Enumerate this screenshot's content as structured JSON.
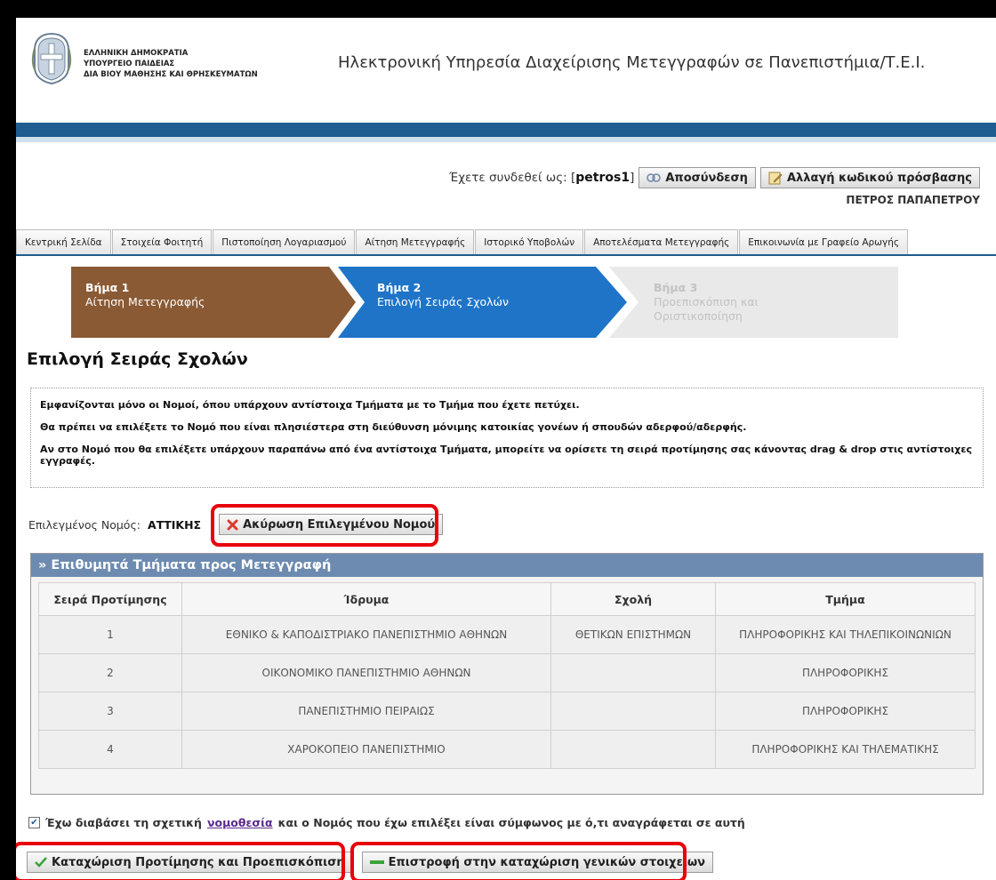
{
  "header": {
    "ministry_lines": [
      "ΕΛΛΗΝΙΚΗ ΔΗΜΟΚΡΑΤΙΑ",
      "ΥΠΟΥΡΓΕΙΟ ΠΑΙΔΕΙΑΣ",
      "ΔΙΑ ΒΙΟΥ ΜΑΘΗΣΗΣ ΚΑΙ ΘΡΗΣΚΕΥΜΑΤΩΝ"
    ],
    "service_title": "Ηλεκτρονική Υπηρεσία Διαχείρισης Μετεγγραφών σε Πανεπιστήμια/Τ.Ε.Ι.",
    "colors": {
      "bar": "#1f5c8f"
    }
  },
  "user": {
    "logged_in_label": "Έχετε συνδεθεί ως: [",
    "username": "petros1",
    "close_bracket": "]",
    "logout_label": "Αποσύνδεση",
    "change_password_label": "Αλλαγή κωδικού πρόσβασης",
    "full_name": "ΠΕΤΡΟΣ ΠΑΠΑΠΕΤΡΟΥ"
  },
  "tabs": [
    {
      "label": "Κεντρική Σελίδα"
    },
    {
      "label": "Στοιχεία Φοιτητή"
    },
    {
      "label": "Πιστοποίηση Λογαριασμού"
    },
    {
      "label": "Αίτηση Μετεγγραφής"
    },
    {
      "label": "Ιστορικό Υποβολών"
    },
    {
      "label": "Αποτελέσματα Μετεγγραφής"
    },
    {
      "label": "Επικοινωνία με Γραφείο Αρωγής"
    }
  ],
  "wizard": {
    "steps": [
      {
        "num": "Βήμα 1",
        "label": "Αίτηση Μετεγγραφής",
        "state": "done",
        "color": "#8a5a34"
      },
      {
        "num": "Βήμα 2",
        "label": "Επιλογή Σειράς Σχολών",
        "state": "current",
        "color": "#1f74c8"
      },
      {
        "num": "Βήμα 3",
        "label": "Προεπισκόπιση και Οριστικοποίηση",
        "state": "pending",
        "color": "#e9e9e9"
      }
    ]
  },
  "page_title": "Επιλογή Σειράς Σχολών",
  "info": {
    "p1": "Εμφανίζονται μόνο οι Νομοί, όπου υπάρχουν αντίστοιχα Τμήματα με το Τμήμα που έχετε πετύχει.",
    "p2": "Θα πρέπει να επιλέξετε το Νομό που είναι πλησιέστερα στη διεύθυνση μόνιμης κατοικίας γονέων ή σπουδών αδερφού/αδερφής.",
    "p3": "Αν στο Νομό που θα επιλέξετε υπάρχουν παραπάνω από ένα αντίστοιχα Τμήματα, μπορείτε να ορίσετε τη σειρά προτίμησης σας κάνοντας drag & drop στις αντίστοιχες εγγραφές."
  },
  "selected": {
    "label": "Επιλεγμένος Νομός:",
    "value": "ΑΤΤΙΚΗΣ",
    "cancel_label": "Ακύρωση Επιλεγμένου Νομού"
  },
  "table": {
    "title": "» Επιθυμητά Τμήματα προς Μετεγγραφή",
    "columns": [
      "Σειρά Προτίμησης",
      "Ίδρυμα",
      "Σχολή",
      "Τμήμα"
    ],
    "rows": [
      [
        "1",
        "ΕΘΝΙΚΟ & ΚΑΠΟΔΙΣΤΡΙΑΚΟ ΠΑΝΕΠΙΣΤΗΜΙΟ ΑΘΗΝΩΝ",
        "ΘΕΤΙΚΩΝ ΕΠΙΣΤΗΜΩΝ",
        "ΠΛΗΡΟΦΟΡΙΚΗΣ ΚΑΙ ΤΗΛΕΠΙΚΟΙΝΩΝΙΩΝ"
      ],
      [
        "2",
        "ΟΙΚΟΝΟΜΙΚΟ ΠΑΝΕΠΙΣΤΗΜΙΟ ΑΘΗΝΩΝ",
        "",
        "ΠΛΗΡΟΦΟΡΙΚΗΣ"
      ],
      [
        "3",
        "ΠΑΝΕΠΙΣΤΗΜΙΟ ΠΕΙΡΑΙΩΣ",
        "",
        "ΠΛΗΡΟΦΟΡΙΚΗΣ"
      ],
      [
        "4",
        "ΧΑΡΟΚΟΠΕΙΟ ΠΑΝΕΠΙΣΤΗΜΙΟ",
        "",
        "ΠΛΗΡΟΦΟΡΙΚΗΣ ΚΑΙ ΤΗΛΕΜΑΤΙΚΗΣ"
      ]
    ]
  },
  "agree": {
    "checked": true,
    "text_before": "Έχω διαβάσει τη σχετική",
    "link": "νομοθεσία",
    "text_after": "και ο Νομός που έχω επιλέξει είναι σύμφωνος με ό,τι αναγράφεται σε αυτή"
  },
  "actions": {
    "submit_label": "Καταχώριση Προτίμησης και Προεπισκόπιση",
    "back_label": "Επιστροφή στην καταχώριση γενικών στοιχείων"
  },
  "icons": {
    "logout": "logout-icon",
    "password": "key-edit-icon",
    "cancel": "red-x-icon",
    "submit": "green-check-icon",
    "back": "green-arrow-icon"
  }
}
